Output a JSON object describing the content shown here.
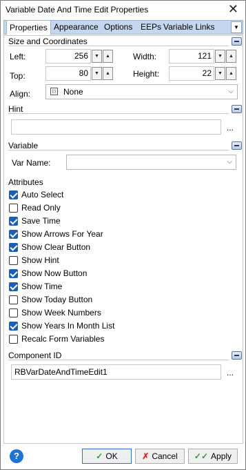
{
  "window": {
    "title": "Variable Date And Time Edit Properties"
  },
  "tabs": [
    "Properties",
    "Appearance",
    "Options",
    "EEPs",
    "Variable Links"
  ],
  "size_coordinates": {
    "header": "Size and Coordinates",
    "left_label": "Left:",
    "left_value": "256",
    "width_label": "Width:",
    "width_value": "121",
    "top_label": "Top:",
    "top_value": "80",
    "height_label": "Height:",
    "height_value": "22",
    "align_label": "Align:",
    "align_value": "None"
  },
  "hint": {
    "header": "Hint",
    "value": "",
    "ellipsis": "..."
  },
  "variable": {
    "header": "Variable",
    "var_name_label": "Var Name:",
    "var_name_value": ""
  },
  "attributes": {
    "header": "Attributes",
    "items": [
      {
        "label": "Auto Select",
        "checked": true
      },
      {
        "label": "Read Only",
        "checked": false
      },
      {
        "label": "Save Time",
        "checked": true
      },
      {
        "label": "Show Arrows For Year",
        "checked": true
      },
      {
        "label": "Show Clear Button",
        "checked": true
      },
      {
        "label": "Show Hint",
        "checked": false
      },
      {
        "label": "Show Now Button",
        "checked": true
      },
      {
        "label": "Show Time",
        "checked": true
      },
      {
        "label": "Show Today Button",
        "checked": false
      },
      {
        "label": "Show Week Numbers",
        "checked": false
      },
      {
        "label": "Show Years In Month List",
        "checked": true
      },
      {
        "label": "Recalc Form Variables",
        "checked": false
      }
    ]
  },
  "component_id": {
    "header": "Component ID",
    "value": "RBVarDateAndTimeEdit1",
    "ellipsis": "..."
  },
  "footer": {
    "help": "?",
    "ok_label": "OK",
    "cancel_label": "Cancel",
    "apply_label": "Apply"
  },
  "colors": {
    "accent": "#1a5fb4",
    "tab_bar": "#c5d7ee"
  }
}
